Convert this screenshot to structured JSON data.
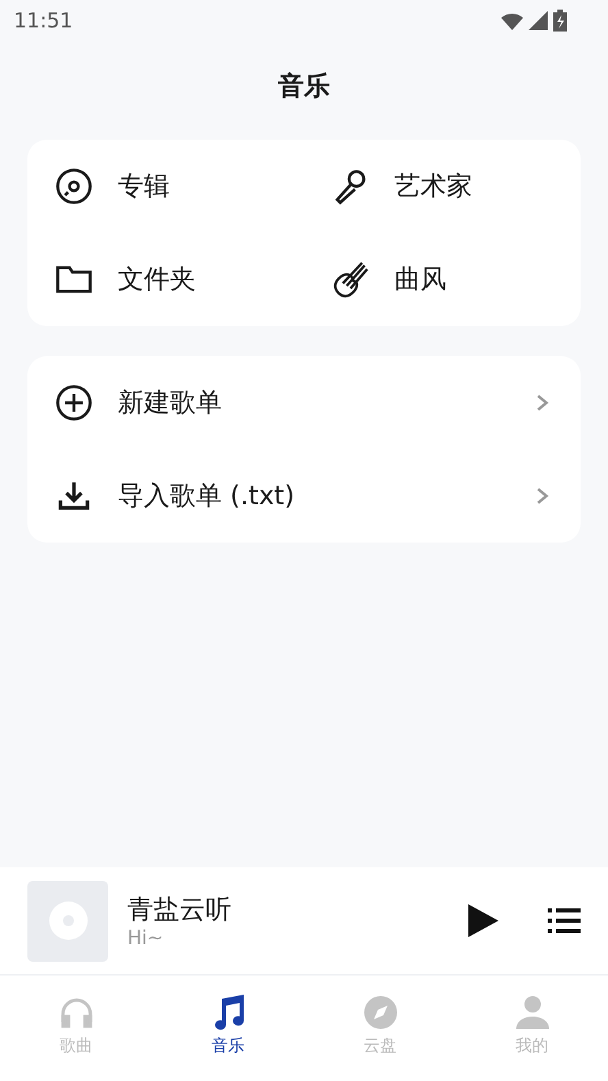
{
  "status_bar": {
    "time": "11:51"
  },
  "header": {
    "title": "音乐"
  },
  "category_grid": [
    {
      "label": "专辑",
      "kind": "disc"
    },
    {
      "label": "艺术家",
      "kind": "mic"
    },
    {
      "label": "文件夹",
      "kind": "folder"
    },
    {
      "label": "曲风",
      "kind": "guitar"
    }
  ],
  "playlist_actions": [
    {
      "label": "新建歌单",
      "kind": "plus"
    },
    {
      "label": "导入歌单 (.txt)",
      "kind": "download"
    }
  ],
  "mini_player": {
    "title": "青盐云听",
    "subtitle": "Hi~"
  },
  "tabs": [
    {
      "label": "歌曲",
      "kind": "headphones",
      "selected": false
    },
    {
      "label": "音乐",
      "kind": "note",
      "selected": true
    },
    {
      "label": "云盘",
      "kind": "compass",
      "selected": false
    },
    {
      "label": "我的",
      "kind": "person",
      "selected": false
    }
  ]
}
